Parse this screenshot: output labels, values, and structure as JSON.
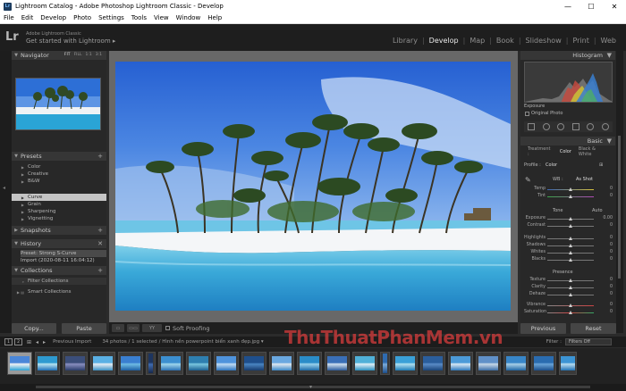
{
  "window": {
    "title": "Lightroom Catalog - Adobe Photoshop Lightroom Classic - Develop",
    "app_icon": "Lr",
    "controls": [
      "—",
      "☐",
      "✕"
    ]
  },
  "menu": [
    "File",
    "Edit",
    "Develop",
    "Photo",
    "Settings",
    "Tools",
    "View",
    "Window",
    "Help"
  ],
  "identity": {
    "logo": "Lr",
    "product": "Adobe Lightroom Classic",
    "tagline": "Get started with Lightroom ▸"
  },
  "modules": {
    "items": [
      "Library",
      "Develop",
      "Map",
      "Book",
      "Slideshow",
      "Print",
      "Web"
    ],
    "active": "Develop"
  },
  "left": {
    "navigator": {
      "title": "Navigator",
      "modes": [
        "FIT",
        "FILL",
        "1:1",
        "3:1"
      ]
    },
    "presets": {
      "title": "Presets",
      "items": [
        "Color",
        "Creative",
        "B&W"
      ],
      "subitems": [
        "Curve",
        "Grain",
        "Sharpening",
        "Vignetting"
      ],
      "selected": "Curve"
    },
    "snapshots": {
      "title": "Snapshots"
    },
    "history": {
      "title": "History",
      "items": [
        "Preset: Strong S-Curve",
        "Import (2020-08-11 16:04:12)"
      ]
    },
    "collections": {
      "title": "Collections",
      "items": [
        "Filter Collections",
        "Smart Collections"
      ]
    },
    "copy_label": "Copy...",
    "paste_label": "Paste"
  },
  "toolbar": {
    "soft_proofing": "Soft Proofing",
    "yy": "YY"
  },
  "right": {
    "histogram_title": "Histogram",
    "exposure_label": "Exposure",
    "original_photo": "Original Photo",
    "basic_title": "Basic",
    "treatment_label": "Treatment :",
    "treatment_options": [
      "Color",
      "Black & White"
    ],
    "profile_label": "Profile :",
    "profile_value": "Color",
    "wb_label": "WB :",
    "wb_value": "As Shot",
    "temp_label": "Temp",
    "temp_value": "0",
    "tint_label": "Tint",
    "tint_value": "0",
    "tone_label": "Tone",
    "auto_label": "Auto",
    "exposure_slider_label": "Exposure",
    "exposure_value": "0.00",
    "contrast_label": "Contrast",
    "contrast_value": "0",
    "highlights_label": "Highlights",
    "highlights_value": "0",
    "shadows_label": "Shadows",
    "shadows_value": "0",
    "whites_label": "Whites",
    "whites_value": "0",
    "blacks_label": "Blacks",
    "blacks_value": "0",
    "presence_label": "Presence",
    "texture_label": "Texture",
    "texture_value": "0",
    "clarity_label": "Clarity",
    "clarity_value": "0",
    "dehaze_label": "Dehaze",
    "dehaze_value": "0",
    "vibrance_label": "Vibrance",
    "vibrance_value": "0",
    "saturation_label": "Saturation",
    "saturation_value": "0",
    "previous_label": "Previous",
    "reset_label": "Reset"
  },
  "filmstrip": {
    "page_1": "1",
    "page_2": "2",
    "source": "Previous Import",
    "info": "34 photos / 1 selected",
    "file": "/ Hình nền powerpoint biển xanh đẹp.jpg ▾",
    "filter_label": "Filter :",
    "filter_value": "Filters Off"
  },
  "watermark": {
    "text1": "ThuThuat",
    "text2": "PhanMem",
    "text3": ".vn"
  },
  "colors": {
    "sky": "#2f6fd8",
    "sea": "#2a9fd0",
    "sand": "#f2f4f6",
    "panel": "#282828",
    "watermark": "#d33b3b"
  }
}
